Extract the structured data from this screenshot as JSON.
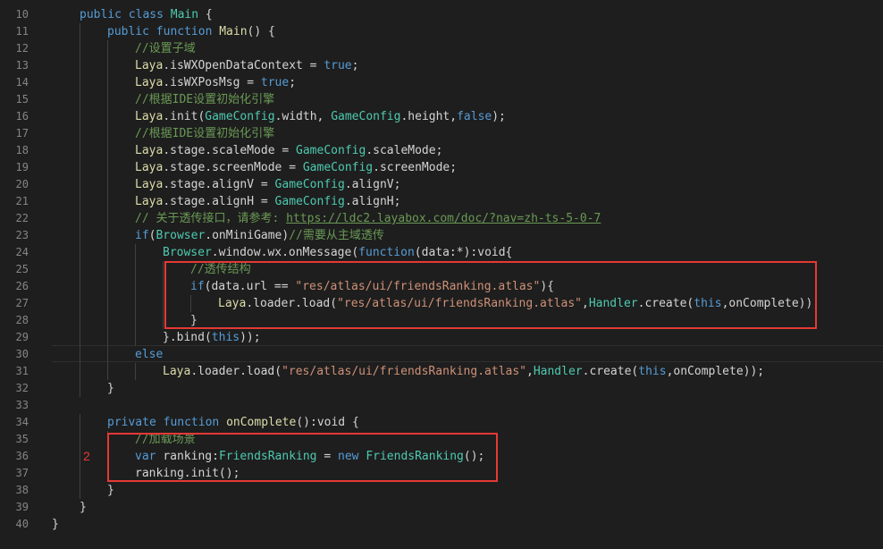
{
  "editor": {
    "lines": [
      {
        "num": "10",
        "indent": 1,
        "tokens": [
          [
            "kw",
            "public class "
          ],
          [
            "cls",
            "Main"
          ],
          [
            "pl",
            " {"
          ]
        ]
      },
      {
        "num": "11",
        "indent": 2,
        "tokens": [
          [
            "kw",
            "public function "
          ],
          [
            "fn",
            "Main"
          ],
          [
            "pl",
            "() {"
          ]
        ]
      },
      {
        "num": "12",
        "indent": 3,
        "tokens": [
          [
            "cm",
            "//设置子域"
          ]
        ]
      },
      {
        "num": "13",
        "indent": 3,
        "tokens": [
          [
            "fn",
            "Laya"
          ],
          [
            "pl",
            ".isWXOpenDataContext = "
          ],
          [
            "kw",
            "true"
          ],
          [
            "pl",
            ";"
          ]
        ]
      },
      {
        "num": "14",
        "indent": 3,
        "tokens": [
          [
            "fn",
            "Laya"
          ],
          [
            "pl",
            ".isWXPosMsg = "
          ],
          [
            "kw",
            "true"
          ],
          [
            "pl",
            ";"
          ]
        ]
      },
      {
        "num": "15",
        "indent": 3,
        "tokens": [
          [
            "cm",
            "//根据IDE设置初始化引擎"
          ]
        ]
      },
      {
        "num": "16",
        "indent": 3,
        "tokens": [
          [
            "fn",
            "Laya"
          ],
          [
            "pl",
            ".init("
          ],
          [
            "cls",
            "GameConfig"
          ],
          [
            "pl",
            ".width, "
          ],
          [
            "cls",
            "GameConfig"
          ],
          [
            "pl",
            ".height,"
          ],
          [
            "kw",
            "false"
          ],
          [
            "pl",
            ");"
          ]
        ]
      },
      {
        "num": "17",
        "indent": 3,
        "tokens": [
          [
            "cm",
            "//根据IDE设置初始化引擎"
          ]
        ]
      },
      {
        "num": "18",
        "indent": 3,
        "tokens": [
          [
            "fn",
            "Laya"
          ],
          [
            "pl",
            ".stage.scaleMode = "
          ],
          [
            "cls",
            "GameConfig"
          ],
          [
            "pl",
            ".scaleMode;"
          ]
        ]
      },
      {
        "num": "19",
        "indent": 3,
        "tokens": [
          [
            "fn",
            "Laya"
          ],
          [
            "pl",
            ".stage.screenMode = "
          ],
          [
            "cls",
            "GameConfig"
          ],
          [
            "pl",
            ".screenMode;"
          ]
        ]
      },
      {
        "num": "20",
        "indent": 3,
        "tokens": [
          [
            "fn",
            "Laya"
          ],
          [
            "pl",
            ".stage.alignV = "
          ],
          [
            "cls",
            "GameConfig"
          ],
          [
            "pl",
            ".alignV;"
          ]
        ]
      },
      {
        "num": "21",
        "indent": 3,
        "tokens": [
          [
            "fn",
            "Laya"
          ],
          [
            "pl",
            ".stage.alignH = "
          ],
          [
            "cls",
            "GameConfig"
          ],
          [
            "pl",
            ".alignH;"
          ]
        ]
      },
      {
        "num": "22",
        "indent": 3,
        "tokens": [
          [
            "cm",
            "// 关于透传接口，请参考: "
          ],
          [
            "link",
            "https://ldc2.layabox.com/doc/?nav=zh-ts-5-0-7"
          ]
        ]
      },
      {
        "num": "23",
        "indent": 3,
        "tokens": [
          [
            "kw",
            "if"
          ],
          [
            "pl",
            "("
          ],
          [
            "cls",
            "Browser"
          ],
          [
            "pl",
            ".onMiniGame)"
          ],
          [
            "cm",
            "//需要从主域透传"
          ]
        ]
      },
      {
        "num": "24",
        "indent": 4,
        "tokens": [
          [
            "cls",
            "Browser"
          ],
          [
            "pl",
            ".window.wx.onMessage("
          ],
          [
            "kw",
            "function"
          ],
          [
            "pl",
            "(data:*):void{"
          ]
        ]
      },
      {
        "num": "25",
        "indent": 5,
        "tokens": [
          [
            "cm",
            "//透传结构"
          ]
        ]
      },
      {
        "num": "26",
        "indent": 5,
        "tokens": [
          [
            "kw",
            "if"
          ],
          [
            "pl",
            "(data.url == "
          ],
          [
            "str",
            "\"res/atlas/ui/friendsRanking.atlas\""
          ],
          [
            "pl",
            "){"
          ]
        ]
      },
      {
        "num": "27",
        "indent": 6,
        "tokens": [
          [
            "fn",
            "Laya"
          ],
          [
            "pl",
            ".loader.load("
          ],
          [
            "str",
            "\"res/atlas/ui/friendsRanking.atlas\""
          ],
          [
            "pl",
            ","
          ],
          [
            "cls",
            "Handler"
          ],
          [
            "pl",
            ".create("
          ],
          [
            "kw",
            "this"
          ],
          [
            "pl",
            ",onComplete));"
          ]
        ]
      },
      {
        "num": "28",
        "indent": 5,
        "tokens": [
          [
            "pl",
            "}"
          ]
        ]
      },
      {
        "num": "29",
        "indent": 4,
        "tokens": [
          [
            "pl",
            "}.bind("
          ],
          [
            "kw",
            "this"
          ],
          [
            "pl",
            "));"
          ]
        ]
      },
      {
        "num": "30",
        "indent": 3,
        "tokens": [
          [
            "kw",
            "else"
          ]
        ]
      },
      {
        "num": "31",
        "indent": 4,
        "tokens": [
          [
            "fn",
            "Laya"
          ],
          [
            "pl",
            ".loader.load("
          ],
          [
            "str",
            "\"res/atlas/ui/friendsRanking.atlas\""
          ],
          [
            "pl",
            ","
          ],
          [
            "cls",
            "Handler"
          ],
          [
            "pl",
            ".create("
          ],
          [
            "kw",
            "this"
          ],
          [
            "pl",
            ",onComplete));"
          ]
        ]
      },
      {
        "num": "32",
        "indent": 2,
        "tokens": [
          [
            "pl",
            "}"
          ]
        ]
      },
      {
        "num": "33",
        "indent": 0,
        "tokens": []
      },
      {
        "num": "34",
        "indent": 2,
        "tokens": [
          [
            "kw",
            "private function "
          ],
          [
            "fn",
            "onComplete"
          ],
          [
            "pl",
            "():void {"
          ]
        ]
      },
      {
        "num": "35",
        "indent": 3,
        "tokens": [
          [
            "cm",
            "//加载场景"
          ]
        ]
      },
      {
        "num": "36",
        "indent": 3,
        "tokens": [
          [
            "kw",
            "var "
          ],
          [
            "pl",
            "ranking:"
          ],
          [
            "cls",
            "FriendsRanking"
          ],
          [
            "pl",
            " = "
          ],
          [
            "kw",
            "new "
          ],
          [
            "cls",
            "FriendsRanking"
          ],
          [
            "pl",
            "();"
          ]
        ]
      },
      {
        "num": "37",
        "indent": 3,
        "tokens": [
          [
            "pl",
            "ranking.init();"
          ]
        ]
      },
      {
        "num": "38",
        "indent": 2,
        "tokens": [
          [
            "pl",
            "}"
          ]
        ]
      },
      {
        "num": "39",
        "indent": 1,
        "tokens": [
          [
            "pl",
            "}"
          ]
        ]
      },
      {
        "num": "40",
        "indent": 0,
        "tokens": [
          [
            "pl",
            "}"
          ]
        ]
      }
    ]
  },
  "annotation": {
    "marker_label": "2",
    "box_color": "#e53935"
  },
  "theme": {
    "background": "#1e1e1e",
    "keyword": "#569cd6",
    "function": "#dcdcaa",
    "class": "#4ec9b0",
    "string": "#ce9178",
    "comment": "#6a9955",
    "plain": "#d4d4d4",
    "line_number": "#858585"
  }
}
